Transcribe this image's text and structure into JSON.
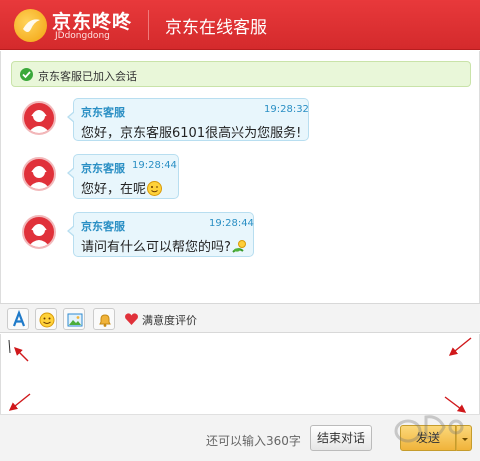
{
  "header": {
    "brand_cn": "京东咚咚",
    "brand_en": "JDdongdong",
    "title": "京东在线客服"
  },
  "notice": {
    "text": "京东客服已加入会话",
    "icon": "check-circle-icon"
  },
  "messages": [
    {
      "sender": "京东客服",
      "time": "19:28:32",
      "text": "您好，京东客服6101很高兴为您服务!",
      "emoji": ""
    },
    {
      "sender": "京东客服",
      "time": "19:28:44",
      "text": "您好，在呢",
      "emoji": "wink-face-icon"
    },
    {
      "sender": "京东客服",
      "time": "19:28:44",
      "text": "请问有什么可以帮您的吗?",
      "emoji": "flower-icon"
    }
  ],
  "toolbar": {
    "items": [
      "font-icon",
      "emoji-icon",
      "image-icon",
      "bell-icon"
    ],
    "rating_label": "满意度评价",
    "rating_icon": "heart-icon"
  },
  "footer": {
    "counter": "还可以输入360字",
    "end_label": "结束对话",
    "send_label": "发送"
  },
  "colors": {
    "header_red": "#e0313a",
    "bubble_bg": "#e8f6fc",
    "sender_blue": "#2a8fc4",
    "send_yellow": "#f0b33a",
    "annotation_arrow": "#d0181b"
  }
}
